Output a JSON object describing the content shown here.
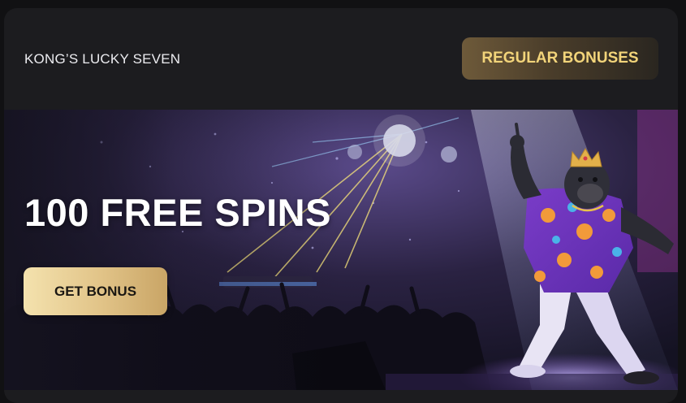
{
  "header": {
    "game_title": "KONG’S LUCKY SEVEN",
    "regular_bonuses_label": "REGULAR BONUSES"
  },
  "promo": {
    "title": "100 FREE SPINS",
    "get_bonus_label": "GET BONUS",
    "image_description": "gorilla-with-crown-dancing-nightclub-illustration"
  },
  "colors": {
    "card_bg": "#1c1c1f",
    "page_bg": "#111113",
    "gold_accent": "#f2d47a",
    "button_gold": "#e1c387"
  }
}
